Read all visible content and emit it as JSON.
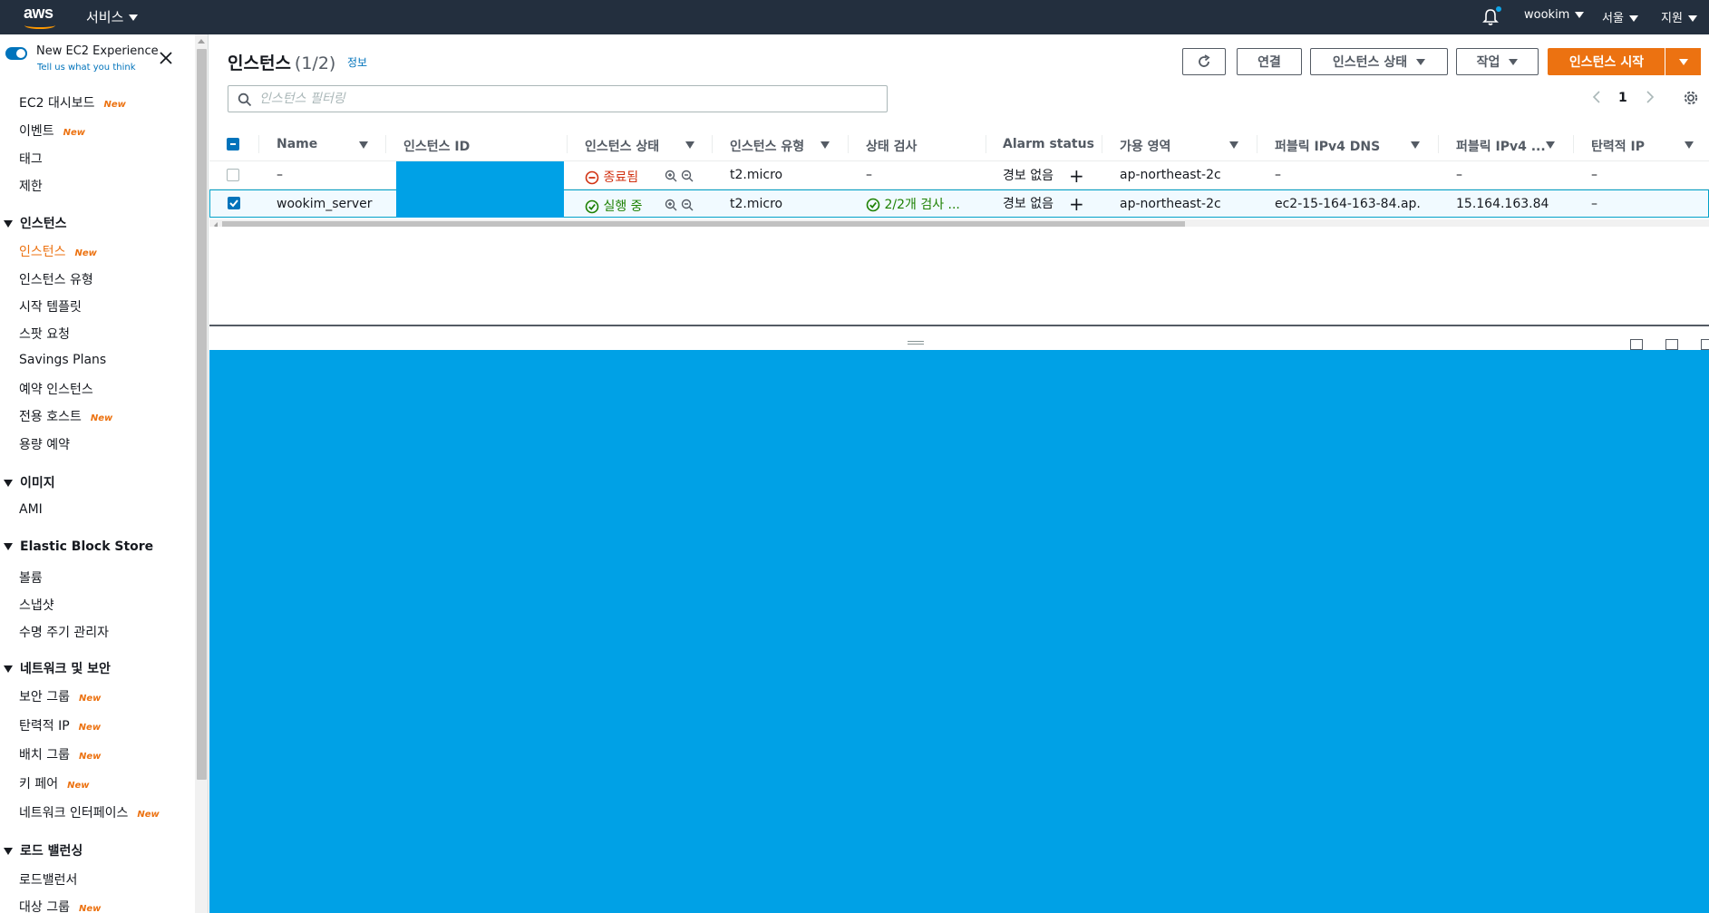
{
  "topbar": {
    "logo": "aws",
    "services_label": "서비스",
    "user": "wookim",
    "region": "서울",
    "support": "지원"
  },
  "sidebar": {
    "experience_title": "New EC2 Experience",
    "experience_sub": "Tell us what you think",
    "new_badge": "New",
    "items": [
      {
        "label": "EC2 대시보드",
        "new": true
      },
      {
        "label": "이벤트",
        "new": true
      },
      {
        "label": "태그",
        "new": false
      },
      {
        "label": "제한",
        "new": false
      }
    ],
    "sections": [
      {
        "title": "인스턴스",
        "items": [
          {
            "label": "인스턴스",
            "new": true,
            "active": true
          },
          {
            "label": "인스턴스 유형",
            "new": false
          },
          {
            "label": "시작 템플릿",
            "new": false
          },
          {
            "label": "스팟 요청",
            "new": false
          },
          {
            "label": "Savings Plans",
            "new": false
          },
          {
            "label": "예약 인스턴스",
            "new": false
          },
          {
            "label": "전용 호스트",
            "new": true
          },
          {
            "label": "용량 예약",
            "new": false
          }
        ]
      },
      {
        "title": "이미지",
        "items": [
          {
            "label": "AMI",
            "new": false
          }
        ]
      },
      {
        "title": "Elastic Block Store",
        "items": [
          {
            "label": "볼륨",
            "new": false
          },
          {
            "label": "스냅샷",
            "new": false
          },
          {
            "label": "수명 주기 관리자",
            "new": false
          }
        ]
      },
      {
        "title": "네트워크 및 보안",
        "items": [
          {
            "label": "보안 그룹",
            "new": true
          },
          {
            "label": "탄력적 IP",
            "new": true
          },
          {
            "label": "배치 그룹",
            "new": true
          },
          {
            "label": "키 페어",
            "new": true
          },
          {
            "label": "네트워크 인터페이스",
            "new": true
          }
        ]
      },
      {
        "title": "로드 밸런싱",
        "items": [
          {
            "label": "로드밸런서",
            "new": false
          },
          {
            "label": "대상 그룹",
            "new": true
          }
        ]
      }
    ]
  },
  "main": {
    "title": "인스턴스",
    "count": "(1/2)",
    "info": "정보",
    "buttons": {
      "connect": "연결",
      "instance_state": "인스턴스 상태",
      "actions": "작업",
      "launch": "인스턴스 시작"
    },
    "search_placeholder": "인스턴스 필터링",
    "page": "1",
    "columns": [
      "Name",
      "인스턴스 ID",
      "인스턴스 상태",
      "인스턴스 유형",
      "상태 검사",
      "Alarm status",
      "가용 영역",
      "퍼블릭 IPv4 DNS",
      "퍼블릭 IPv4 ...",
      "탄력적 IP"
    ],
    "rows": [
      {
        "name": "–",
        "state": "종료됨",
        "type": "t2.micro",
        "status_check": "–",
        "alarm": "경보 없음",
        "az": "ap-northeast-2c",
        "dns": "–",
        "ip": "–",
        "eip": "–",
        "selected": false
      },
      {
        "name": "wookim_server",
        "state": "실행 중",
        "type": "t2.micro",
        "status_check": "2/2개 검사 ...",
        "alarm": "경보 없음",
        "az": "ap-northeast-2c",
        "dns": "ec2-15-164-163-84.ap...",
        "ip": "15.164.163.84",
        "eip": "–",
        "selected": true
      }
    ]
  },
  "colors": {
    "topbar": "#232f3e",
    "accent": "#ec7211",
    "link": "#0073bb",
    "redaction": "#00a1e6"
  }
}
